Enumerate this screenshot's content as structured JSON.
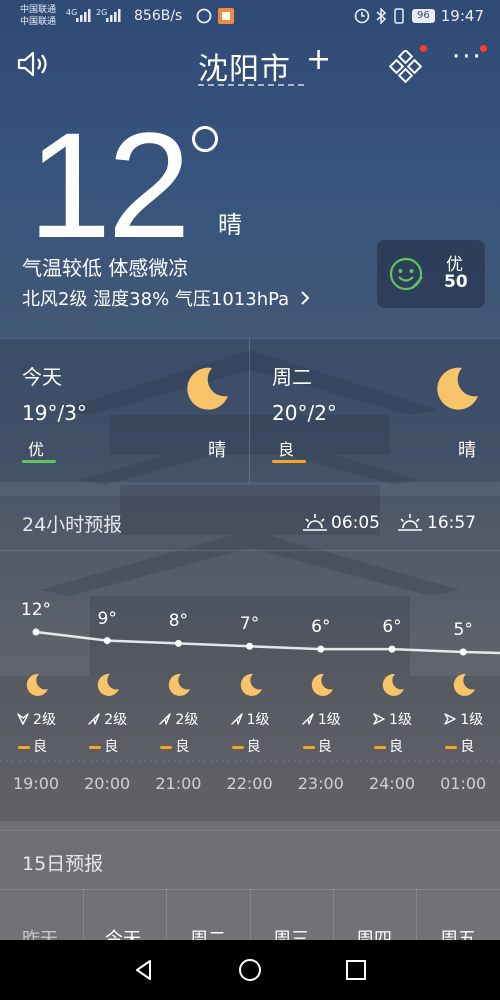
{
  "status_bar": {
    "carrier_1": "中国联通",
    "carrier_2": "中国联通",
    "net_1": "4G",
    "net_2": "2G",
    "net_speed": "856B/s",
    "battery": "96",
    "time": "19:47"
  },
  "header": {
    "city": "沈阳市",
    "add_label": "+",
    "more_label": "···",
    "speaker_icon": "speaker-icon",
    "grid_icon": "grid-icon"
  },
  "current": {
    "temperature": "12",
    "condition": "晴",
    "feel_text": "气温较低 体感微凉",
    "wind_line": "北风2级  湿度38%  气压1013hPa",
    "aqi_level": "优",
    "aqi_value": "50"
  },
  "days": [
    {
      "name": "今天",
      "temp": "19°/3°",
      "aqi": "优",
      "aqi_color": "#5fc45a",
      "condition": "晴"
    },
    {
      "name": "周二",
      "temp": "20°/2°",
      "aqi": "良",
      "aqi_color": "#f5a623",
      "condition": "晴"
    }
  ],
  "hourly": {
    "title": "24小时预报",
    "sunrise": "06:05",
    "sunset": "16:57",
    "hours": [
      {
        "temp": "12°",
        "value": 12,
        "wind": "2级",
        "aqi": "良",
        "time": "19:00",
        "wind_icon": "wind-north-icon"
      },
      {
        "temp": "9°",
        "value": 9,
        "wind": "2级",
        "aqi": "良",
        "time": "20:00",
        "wind_icon": "wind-northeast-icon"
      },
      {
        "temp": "8°",
        "value": 8,
        "wind": "2级",
        "aqi": "良",
        "time": "21:00",
        "wind_icon": "wind-northeast-icon"
      },
      {
        "temp": "7°",
        "value": 7,
        "wind": "1级",
        "aqi": "良",
        "time": "22:00",
        "wind_icon": "wind-northeast-icon"
      },
      {
        "temp": "6°",
        "value": 6,
        "wind": "1级",
        "aqi": "良",
        "time": "23:00",
        "wind_icon": "wind-northeast-icon"
      },
      {
        "temp": "6°",
        "value": 6,
        "wind": "1级",
        "aqi": "良",
        "time": "24:00",
        "wind_icon": "wind-east-icon"
      },
      {
        "temp": "5°",
        "value": 5,
        "wind": "1级",
        "aqi": "良",
        "time": "01:00",
        "wind_icon": "wind-east-icon"
      }
    ]
  },
  "forecast15": {
    "title": "15日预报",
    "days": [
      "昨天",
      "今天",
      "周二",
      "周三",
      "周四",
      "周五"
    ]
  },
  "colors": {
    "aqi_good": "#5fc45a",
    "aqi_moderate": "#f5a623",
    "moon": "#f7c469"
  }
}
